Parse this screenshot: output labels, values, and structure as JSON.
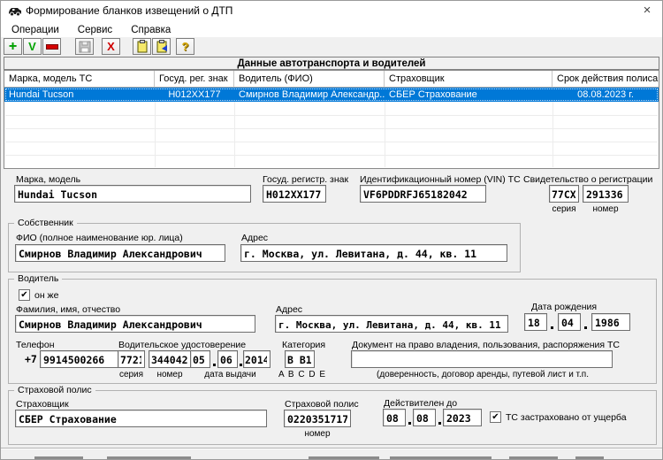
{
  "colors": {
    "selection": "#0078d7",
    "window_bg": "#f0f0f0",
    "titlebar_bg": "#ffffff"
  },
  "glyphs": {
    "check": "✔"
  },
  "window": {
    "title": "Формирование бланков извещений о ДТП",
    "close_glyph": "×"
  },
  "menu": {
    "items": [
      "Операции",
      "Сервис",
      "Справка"
    ]
  },
  "toolbar": {
    "add_glyph": "+",
    "confirm_glyph": "V",
    "cancel_glyph": "X",
    "help_glyph": "?"
  },
  "panel": {
    "title": "Данные автотранспорта и водителей"
  },
  "table": {
    "columns": [
      "Марка, модель ТС",
      "Госуд. рег. знак",
      "Водитель (ФИО)",
      "Страховщик",
      "Срок действия полиса"
    ],
    "selected_row": {
      "make": "Hundai Tucson",
      "plate": "Н012ХХ177",
      "driver": "Смирнов Владимир Александр...",
      "insurer": "СБЕР Страхование",
      "valid": "08.08.2023 г."
    }
  },
  "vehicle": {
    "make_label": "Марка, модель",
    "make": "Hundai Tucson",
    "plate_label": "Госуд. регистр. знак",
    "plate": "Н012ХХ177",
    "vin_label": "Идентификационный номер (VIN) ТС",
    "vin": "VF6PDDRFJ65182042",
    "cert_label": "Свидетельство о регистрации",
    "cert_series": "77СХ",
    "cert_number": "291336",
    "series_caption": "серия",
    "number_caption": "номер"
  },
  "owner": {
    "group_label": "Собственник",
    "fio_label": "ФИО (полное наименование юр. лица)",
    "fio": "Смирнов Владимир Александрович",
    "address_label": "Адрес",
    "address": "г. Москва, ул. Левитана, д. 44, кв. 11"
  },
  "driver": {
    "group_label": "Водитель",
    "same_checkbox_label": "он же",
    "name_label": "Фамилия, имя, отчество",
    "name": "Смирнов Владимир Александрович",
    "address_label": "Адрес",
    "address": "г. Москва, ул. Левитана, д. 44, кв. 11",
    "birth_label": "Дата рождения",
    "birth_day": "18",
    "birth_month": "04",
    "birth_year": "1986",
    "phone_label": "Телефон",
    "phone_prefix": "+7",
    "phone": "9914500266",
    "license_label": "Водительское удостоверение",
    "license_series": "7721",
    "license_number": "344042",
    "series_caption": "серия",
    "number_caption": "номер",
    "issue_day": "05",
    "issue_month": "06",
    "issue_year": "2014",
    "issue_caption": "дата выдачи",
    "category_label": "Категория",
    "category": "В В1",
    "category_hint": "A B C D E",
    "doc_label": "Документ на право владения, пользования, распоряжения ТС",
    "doc_value": "",
    "doc_hint": "(доверенность, договор аренды, путевой лист и т.п."
  },
  "policy": {
    "group_label": "Страховой полис",
    "insurer_label": "Страховщик",
    "insurer": "СБЕР Страхование",
    "policy_label": "Страховой полис",
    "policy_number": "0220351717",
    "number_caption": "номер",
    "valid_label": "Действителен до",
    "valid_day": "08",
    "valid_month": "08",
    "valid_year": "2023",
    "damage_checkbox_label": "ТС застраховано от ущерба"
  }
}
